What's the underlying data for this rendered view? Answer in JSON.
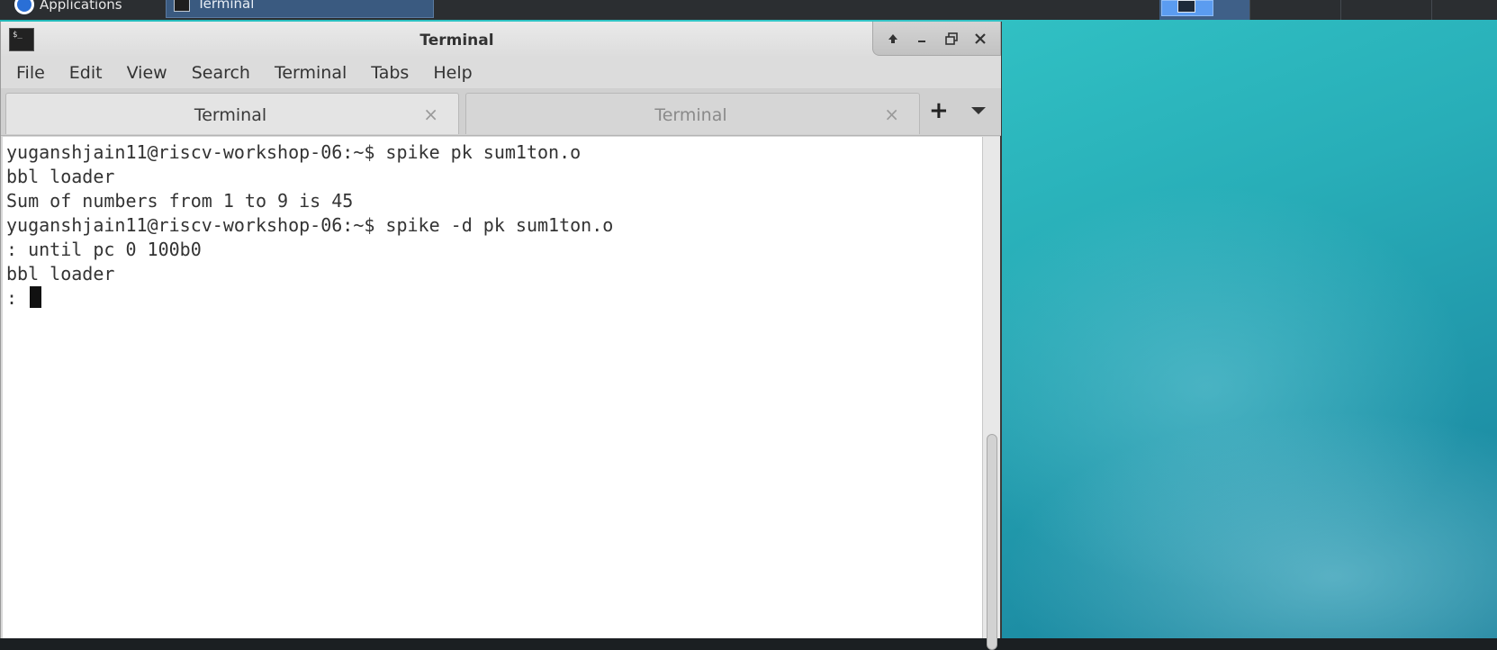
{
  "panel": {
    "applications_label": "Applications",
    "task_label": "Terminal"
  },
  "window": {
    "title": "Terminal",
    "controls": {
      "shade": "shade-icon",
      "minimize": "minimize-icon",
      "maximize": "maximize-icon",
      "close": "close-icon"
    }
  },
  "menubar": {
    "items": [
      "File",
      "Edit",
      "View",
      "Search",
      "Terminal",
      "Tabs",
      "Help"
    ]
  },
  "tabs": [
    {
      "label": "Terminal",
      "active": true
    },
    {
      "label": "Terminal",
      "active": false
    }
  ],
  "terminal": {
    "lines": [
      "yuganshjain11@riscv-workshop-06:~$ spike pk sum1ton.o",
      "bbl loader",
      "Sum of numbers from 1 to 9 is 45",
      "yuganshjain11@riscv-workshop-06:~$ spike -d pk sum1ton.o",
      ": until pc 0 100b0",
      "bbl loader",
      ": "
    ]
  },
  "colors": {
    "desktop": "#28b4bc",
    "panel": "#2b2e31",
    "terminal_bg": "#ffffff",
    "terminal_fg": "#333333"
  }
}
